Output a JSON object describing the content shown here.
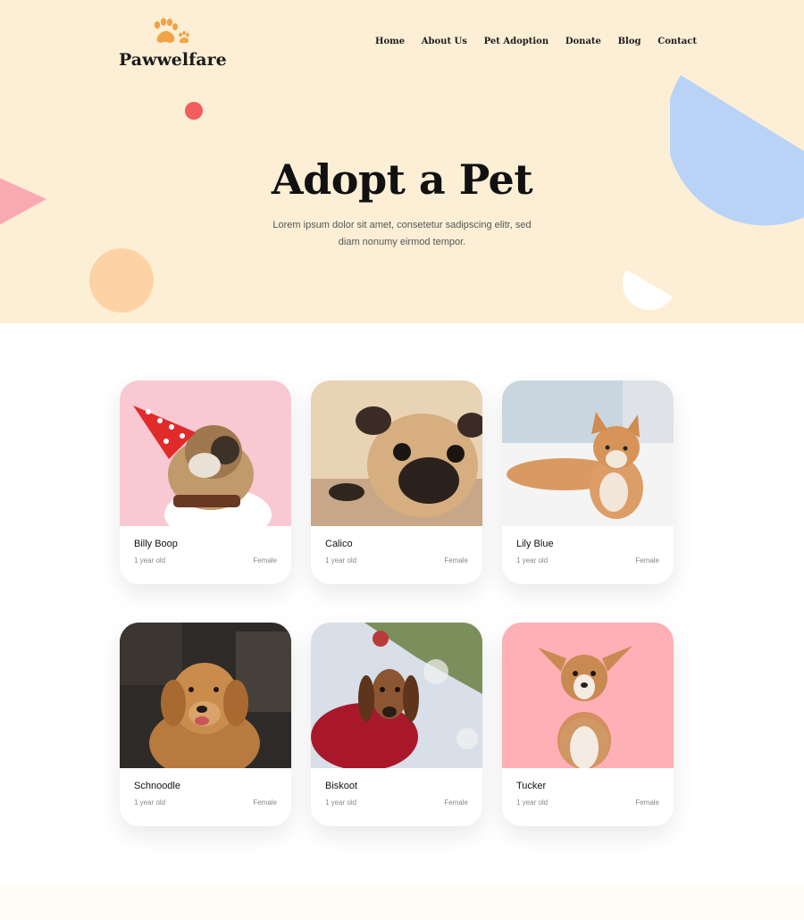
{
  "brand": {
    "name": "Pawwelfare",
    "logo_icon": "paw-icon",
    "accent": "#f0a446"
  },
  "nav": {
    "items": [
      "Home",
      "About Us",
      "Pet Adoption",
      "Donate",
      "Blog",
      "Contact"
    ]
  },
  "hero": {
    "title": "Adopt a Pet",
    "subtitle": "Lorem ipsum dolor sit amet, consetetur sadipscing elitr, sed diam nonumy eirmod tempor.",
    "background": "#fdefd6"
  },
  "pets": [
    {
      "name": "Billy Boop",
      "age": "1 year old",
      "gender": "Female",
      "photo": "french-bulldog-party-hat"
    },
    {
      "name": "Calico",
      "age": "1 year old",
      "gender": "Female",
      "photo": "pug-lying"
    },
    {
      "name": "Lily Blue",
      "age": "1 year old",
      "gender": "Female",
      "photo": "shiba-puppy-on-rug"
    },
    {
      "name": "Schnoodle",
      "age": "1 year old",
      "gender": "Female",
      "photo": "golden-retriever"
    },
    {
      "name": "Biskoot",
      "age": "1 year old",
      "gender": "Female",
      "photo": "dachshund-red-sweater"
    },
    {
      "name": "Tucker",
      "age": "1 year old",
      "gender": "Female",
      "photo": "corgi-puppy-pink"
    }
  ]
}
